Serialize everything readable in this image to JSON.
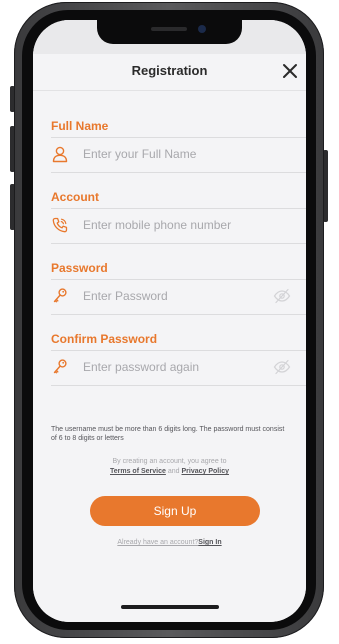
{
  "colors": {
    "accent": "#e8782d",
    "background": "#f4f4f6",
    "divider": "#dcdcde",
    "placeholder": "#a8a8ac"
  },
  "nav": {
    "title": "Registration",
    "close_icon": "close-icon"
  },
  "fields": [
    {
      "label": "Full Name",
      "placeholder": "Enter your Full Name",
      "value": "",
      "icon": "user-icon"
    },
    {
      "label": "Account",
      "placeholder": "Enter mobile phone number",
      "value": "",
      "icon": "phone-icon"
    },
    {
      "label": "Password",
      "placeholder": "Enter Password",
      "value": "",
      "icon": "key-icon",
      "visibility_icon": "eye-slash-icon"
    },
    {
      "label": "Confirm Password",
      "placeholder": "Enter password again",
      "value": "",
      "icon": "key-icon",
      "visibility_icon": "eye-slash-icon"
    }
  ],
  "hint": "The username must be more than 6 digits long. The password must consist of 6 to 8 digits or letters",
  "agreement": {
    "prefix": "By creating an account, you agree to",
    "terms_link": "Terms of Service",
    "conjunction": "and",
    "privacy_link": "Privacy Policy"
  },
  "signup_button": "Sign Up",
  "signin": {
    "question": "Already have an account?",
    "link": "Sign In"
  }
}
